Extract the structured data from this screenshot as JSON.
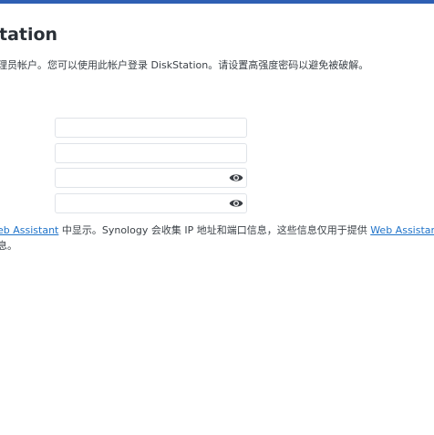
{
  "header": {
    "accent_color": "#2e5fb3",
    "title": "tation"
  },
  "description": "理员帐户。您可以使用此帐户登录 DiskStation。请设置高强度密码以避免被破解。",
  "form": {
    "fields": [
      {
        "value": "",
        "placeholder": ""
      },
      {
        "value": "",
        "placeholder": ""
      },
      {
        "value": "",
        "placeholder": "",
        "icon": "eye-icon"
      },
      {
        "value": "",
        "placeholder": "",
        "icon": "eye-icon"
      }
    ]
  },
  "note": {
    "link1": "eb Assistant",
    "text1": " 中显示。Synology 会收集 IP 地址和端口信息，这些信息仅用于提供 ",
    "link2": "Web Assistant",
    "line2": "息。",
    "link_color": "#1f73c9"
  }
}
